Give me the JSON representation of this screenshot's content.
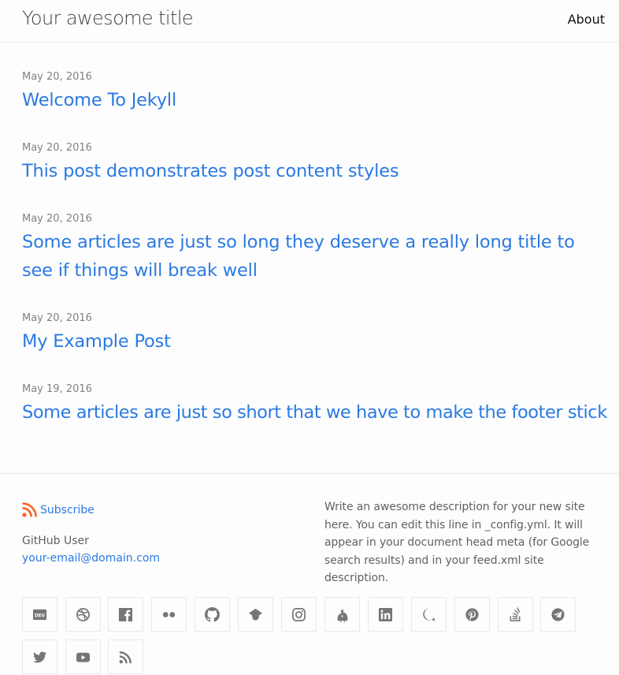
{
  "header": {
    "site_title": "Your awesome title",
    "nav_about": "About"
  },
  "posts": [
    {
      "date": "May 20, 2016",
      "title": "Welcome To Jekyll"
    },
    {
      "date": "May 20, 2016",
      "title": "This post demonstrates post content styles"
    },
    {
      "date": "May 20, 2016",
      "title": "Some articles are just so long they deserve a really long title to see if things will break well"
    },
    {
      "date": "May 20, 2016",
      "title": "My Example Post"
    },
    {
      "date": "May 19, 2016",
      "title": "Some articles are just so short that we have to make the footer stick"
    }
  ],
  "footer": {
    "subscribe": "Subscribe",
    "author_name": "GitHub User",
    "email": "your-email@domain.com",
    "description": "Write an awesome description for your new site here. You can edit this line in _config.yml. It will appear in your document head meta (for Google search results) and in your feed.xml site description.",
    "social_icons": [
      "dev-icon",
      "dribbble-icon",
      "facebook-icon",
      "flickr-icon",
      "github-icon",
      "google-scholar-icon",
      "instagram-icon",
      "keybase-icon",
      "linkedin-icon",
      "mastodon-icon",
      "pinterest-icon",
      "stackoverflow-icon",
      "telegram-icon",
      "twitter-icon",
      "youtube-icon",
      "rss-icon"
    ]
  },
  "colors": {
    "link": "#2a7ae2",
    "meta": "#828282",
    "border": "#e8e8e8",
    "rss": "#f26522",
    "icon": "#767676"
  }
}
